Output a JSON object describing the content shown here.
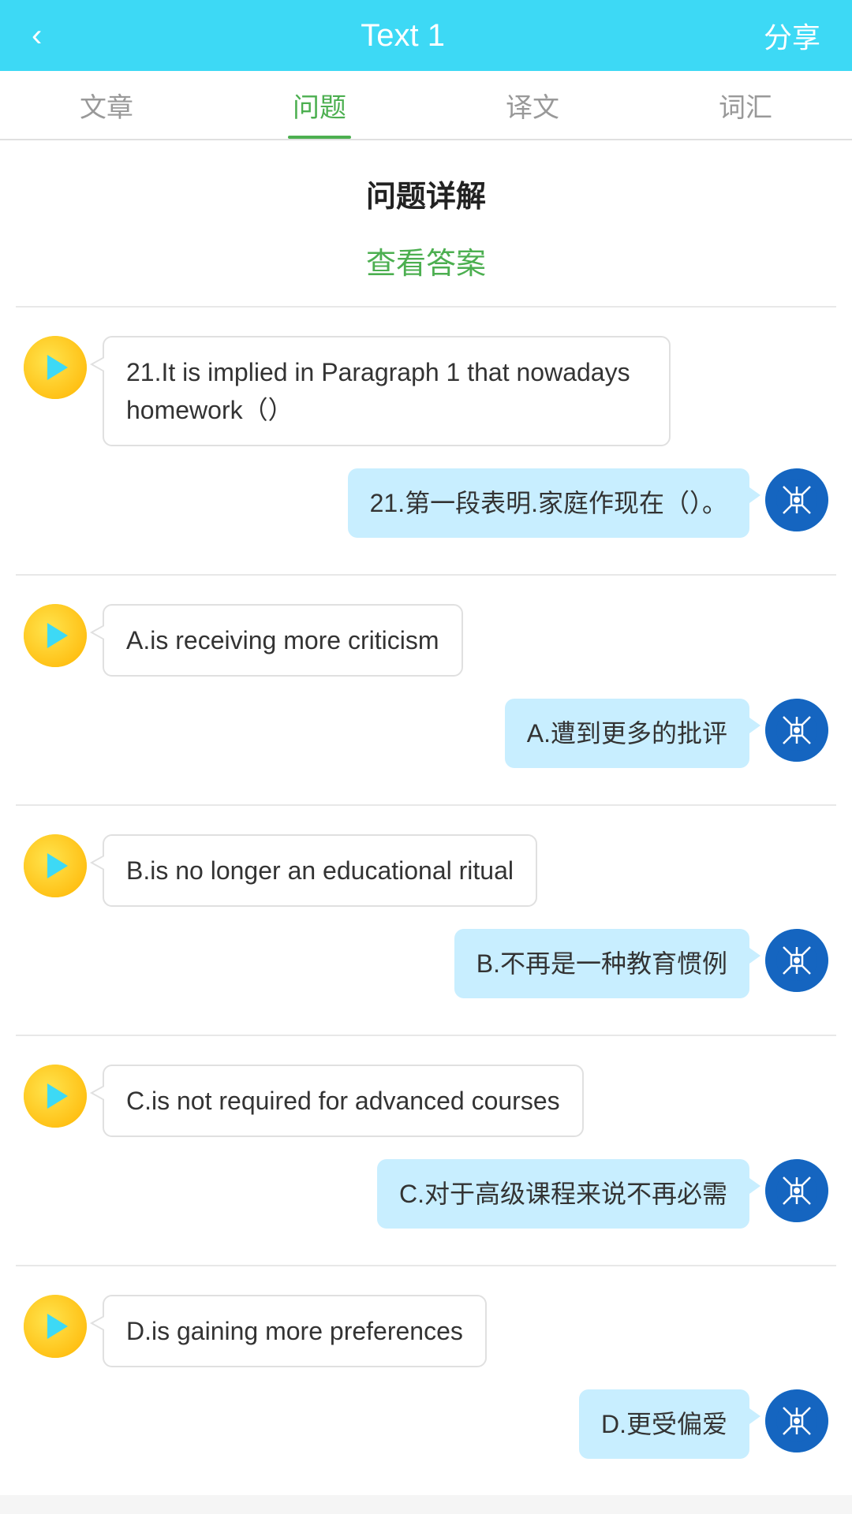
{
  "header": {
    "back_label": "‹",
    "title": "Text 1",
    "share_label": "分享"
  },
  "tabs": [
    {
      "label": "文章",
      "active": false
    },
    {
      "label": "问题",
      "active": true
    },
    {
      "label": "译文",
      "active": false
    },
    {
      "label": "词汇",
      "active": false
    }
  ],
  "section_title": "问题详解",
  "view_answer": "查看答案",
  "qa_pairs": [
    {
      "id": "q21",
      "bot_message": "21.It is implied in Paragraph 1 that nowadays homework（）",
      "user_message": "21.第一段表明.家庭作现在（）。"
    },
    {
      "id": "optA",
      "bot_message": "A.is receiving more criticism",
      "user_message": "A.遭到更多的批评"
    },
    {
      "id": "optB",
      "bot_message": "B.is no longer an educational ritual",
      "user_message": "B.不再是一种教育惯例"
    },
    {
      "id": "optC",
      "bot_message": "C.is not required for advanced courses",
      "user_message": "C.对于高级课程来说不再必需"
    },
    {
      "id": "optD",
      "bot_message": "D.is gaining more preferences",
      "user_message": "D.更受偏爱"
    }
  ]
}
